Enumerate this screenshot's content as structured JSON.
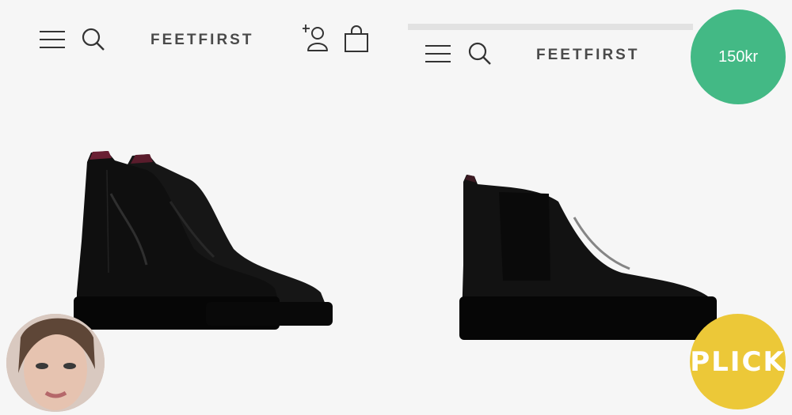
{
  "left": {
    "brand": "FEETFIRST",
    "icons": [
      "menu-icon",
      "search-icon",
      "add-user-icon",
      "shopping-bag-icon"
    ]
  },
  "right": {
    "brand": "FEETFIRST",
    "icons": [
      "menu-icon",
      "search-icon"
    ]
  },
  "badges": {
    "price": "150kr",
    "price_color": "#43b985",
    "plick": "PLICK",
    "plick_color": "#ecc838"
  },
  "products": {
    "left_image": "pair-of-black-chelsea-boots",
    "right_image": "single-black-chelsea-boot"
  }
}
